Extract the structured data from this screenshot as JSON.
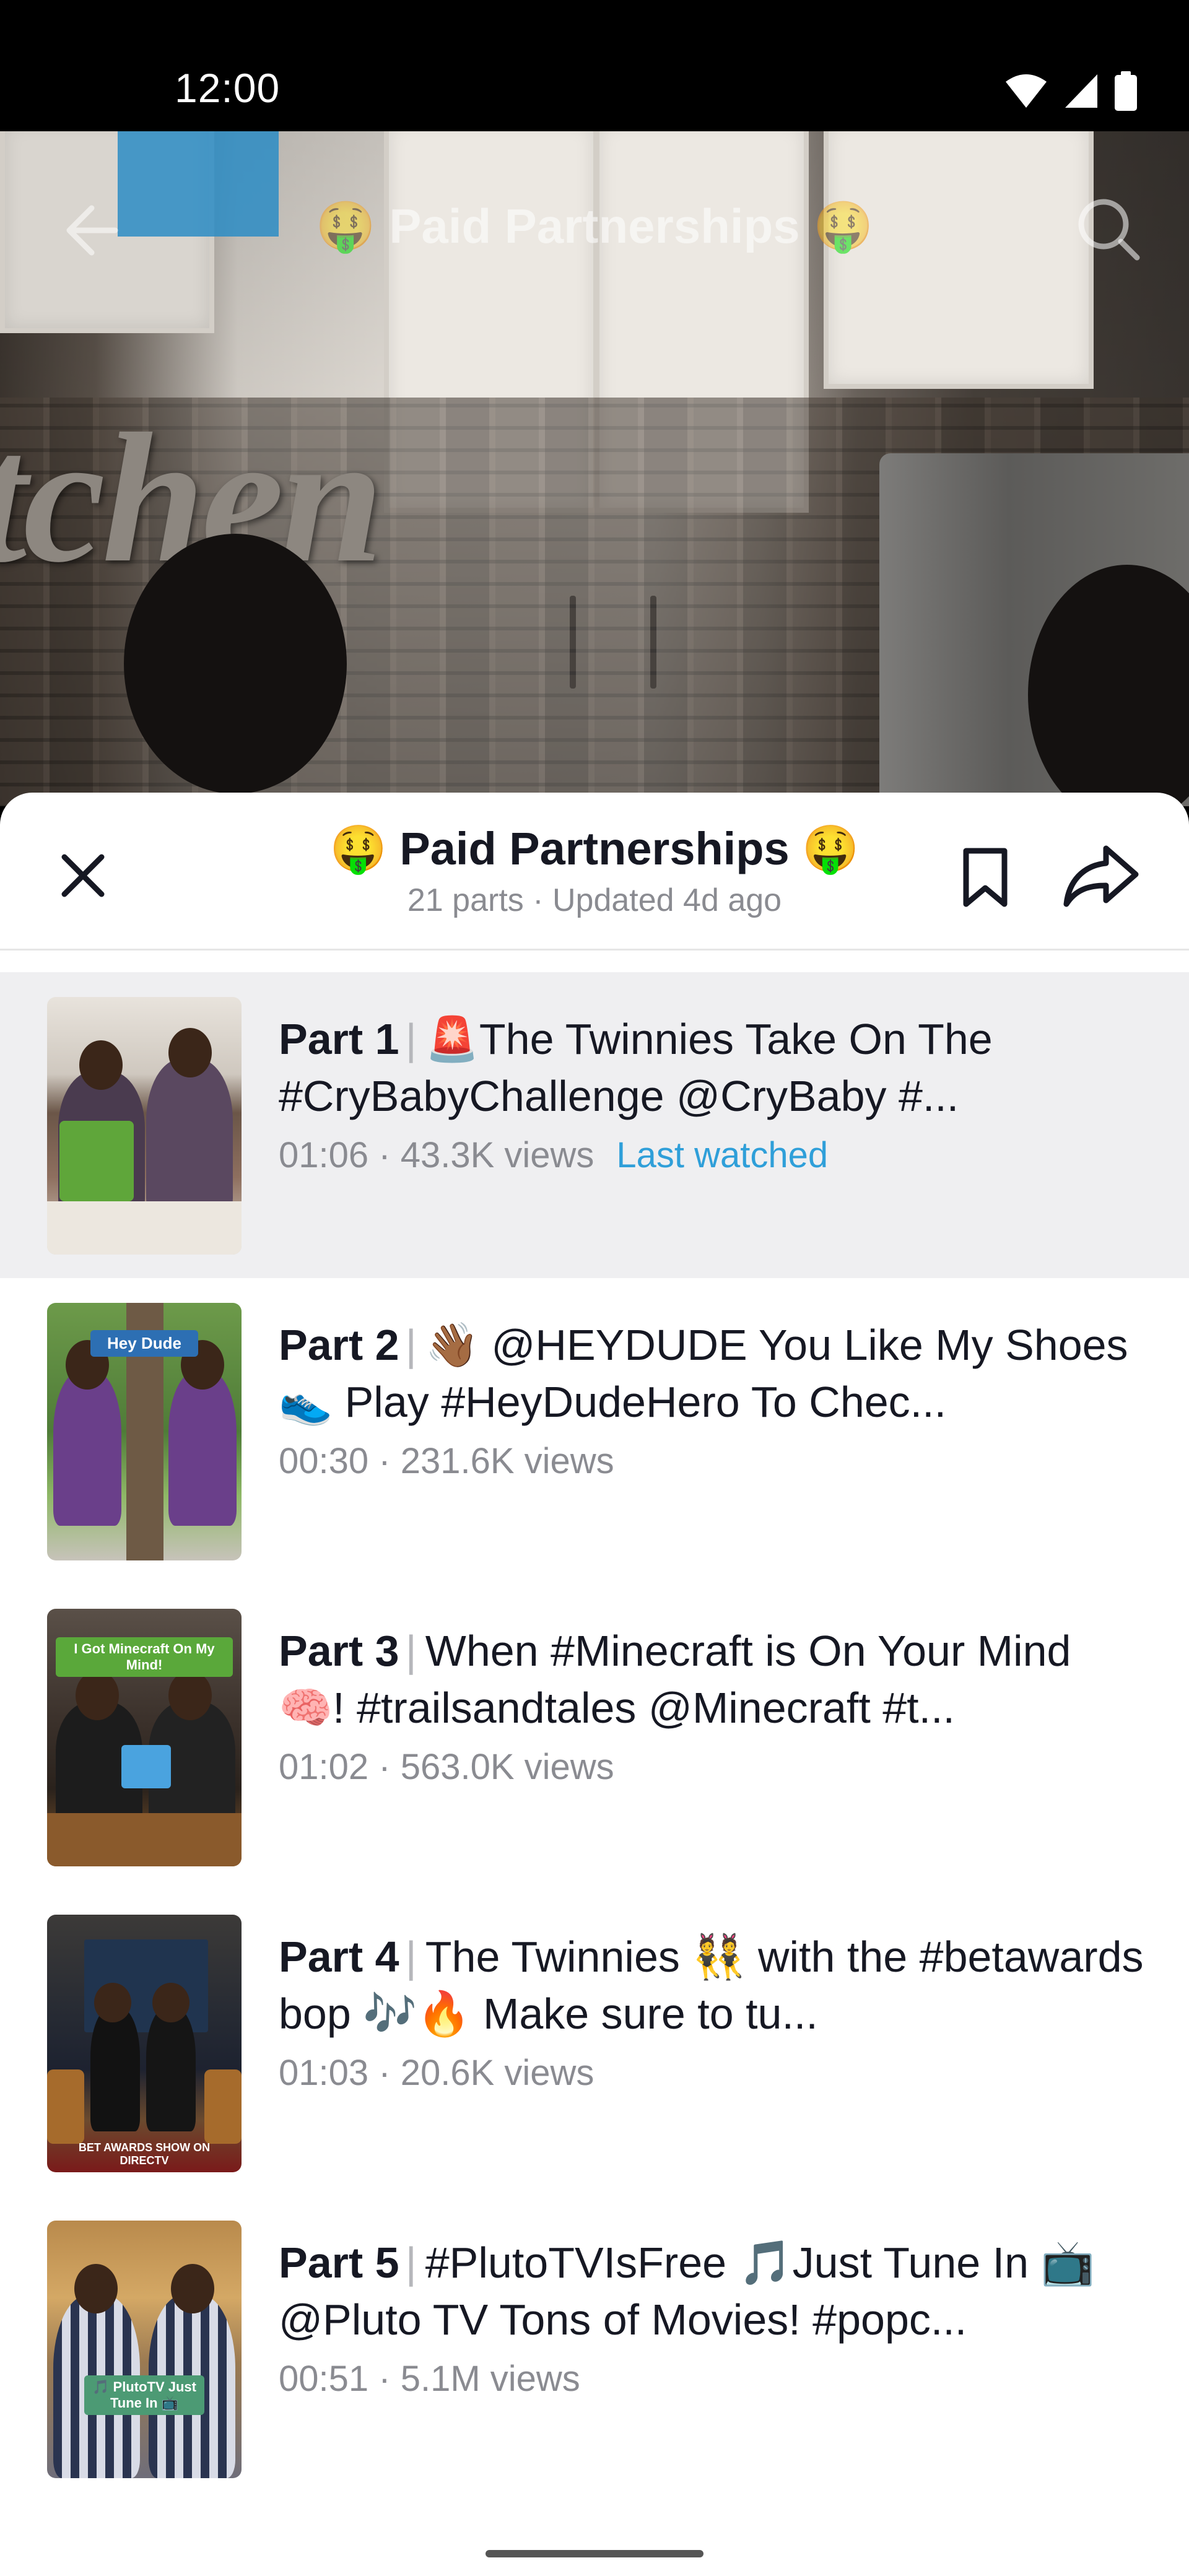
{
  "status_bar": {
    "time": "12:00"
  },
  "video": {
    "title": "🤑 Paid Partnerships 🤑"
  },
  "sheet": {
    "title": "🤑 Paid Partnerships 🤑",
    "subtitle": "21 parts · Updated 4d ago"
  },
  "parts": [
    {
      "part": "Part 1",
      "title": "🚨The Twinnies Take On The #CryBabyChallenge @CryBaby   #...",
      "duration": "01:06",
      "views": "43.3K views",
      "last_watched": "Last watched",
      "active": true
    },
    {
      "part": "Part 2",
      "title": "👋🏾 @HEYDUDE You Like My Shoes 👟 Play #HeyDudeHero To Chec...",
      "duration": "00:30",
      "views": "231.6K views",
      "thumb_label": "Hey Dude",
      "active": false
    },
    {
      "part": "Part 3",
      "title": "When #Minecraft is On Your Mind 🧠! #trailsandtales @Minecraft #t...",
      "duration": "01:02",
      "views": "563.0K views",
      "thumb_label": "I Got Minecraft On My Mind!",
      "active": false
    },
    {
      "part": "Part 4",
      "title": "The Twinnies 👯 with the #betawards bop 🎶🔥  Make sure to tu...",
      "duration": "01:03",
      "views": "20.6K views",
      "thumb_label": "BET AWARDS SHOW ON DIRECTV",
      "active": false
    },
    {
      "part": "Part 5",
      "title": "#PlutoTVIsFree 🎵Just Tune In 📺 @Pluto TV Tons of Movies! #popc...",
      "duration": "00:51",
      "views": "5.1M views",
      "thumb_label": "🎵 PlutoTV Just Tune In 📺",
      "active": false
    }
  ]
}
